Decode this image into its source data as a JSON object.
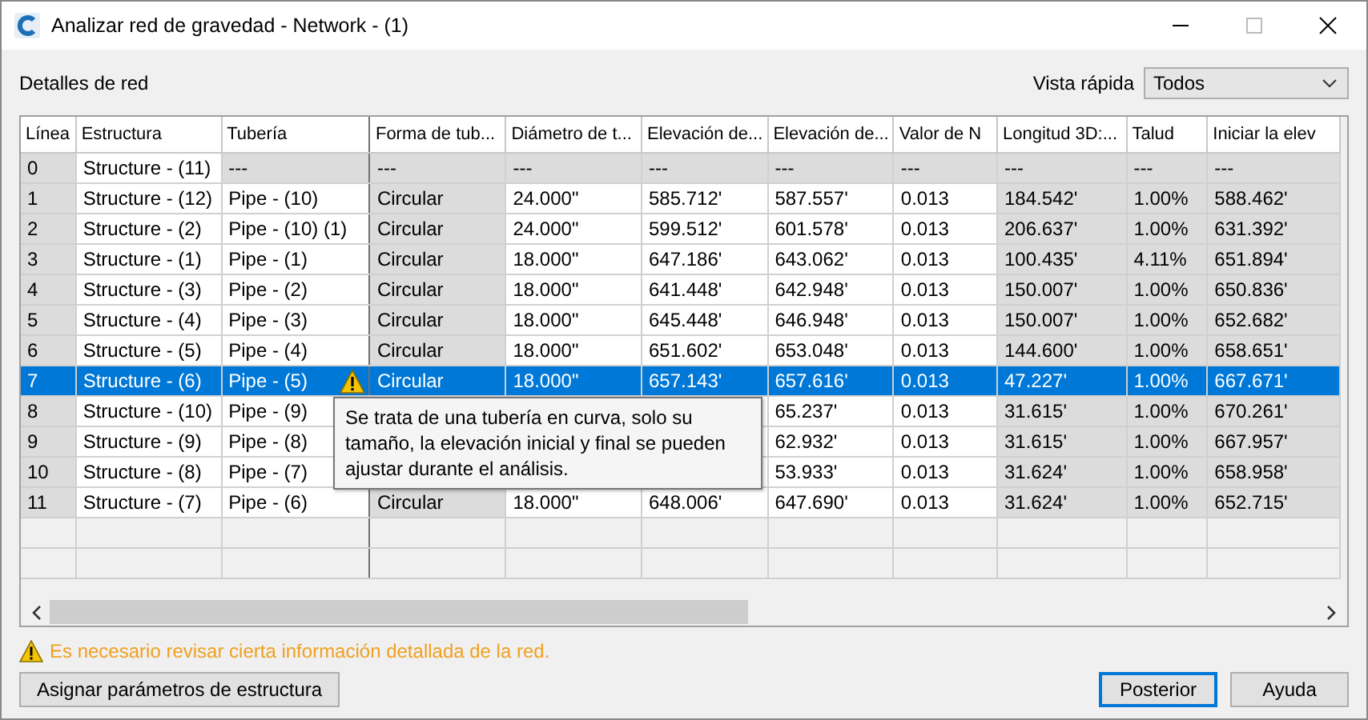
{
  "window": {
    "title": "Analizar red de gravedad - Network - (1)"
  },
  "section_label": "Detalles de red",
  "quick_view": {
    "label": "Vista rápida",
    "value": "Todos"
  },
  "table": {
    "columns": [
      {
        "label": "Línea",
        "editable": false,
        "summary_editable": false,
        "frozen": false
      },
      {
        "label": "Estructura",
        "editable": true,
        "summary_editable": true,
        "frozen": false
      },
      {
        "label": "Tubería",
        "editable": true,
        "summary_editable": false,
        "frozen": true
      },
      {
        "label": "Forma de tub...",
        "editable": false,
        "summary_editable": false,
        "frozen": false
      },
      {
        "label": "Diámetro de t...",
        "editable": true,
        "summary_editable": false,
        "frozen": false
      },
      {
        "label": "Elevación de...",
        "editable": true,
        "summary_editable": false,
        "frozen": false
      },
      {
        "label": "Elevación de...",
        "editable": true,
        "summary_editable": false,
        "frozen": false
      },
      {
        "label": "Valor de N",
        "editable": true,
        "summary_editable": false,
        "frozen": false
      },
      {
        "label": "Longitud 3D:...",
        "editable": false,
        "summary_editable": false,
        "frozen": false
      },
      {
        "label": "Talud",
        "editable": false,
        "summary_editable": false,
        "frozen": false
      },
      {
        "label": "Iniciar la elev",
        "editable": false,
        "summary_editable": false,
        "frozen": false
      }
    ],
    "rows": [
      {
        "kind": "summary",
        "selected": false,
        "warning": false,
        "cells": [
          "0",
          "Structure - (11)",
          "---",
          "---",
          "---",
          "---",
          "---",
          "---",
          "---",
          "---",
          "---"
        ]
      },
      {
        "kind": "pipe",
        "selected": false,
        "warning": false,
        "cells": [
          "1",
          "Structure - (12)",
          "Pipe - (10)",
          "Circular",
          "24.000\"",
          "585.712'",
          "587.557'",
          "0.013",
          "184.542'",
          "1.00%",
          "588.462'"
        ]
      },
      {
        "kind": "pipe",
        "selected": false,
        "warning": false,
        "cells": [
          "2",
          "Structure - (2)",
          "Pipe - (10) (1)",
          "Circular",
          "24.000\"",
          "599.512'",
          "601.578'",
          "0.013",
          "206.637'",
          "1.00%",
          "631.392'"
        ]
      },
      {
        "kind": "pipe",
        "selected": false,
        "warning": false,
        "cells": [
          "3",
          "Structure - (1)",
          "Pipe - (1)",
          "Circular",
          "18.000\"",
          "647.186'",
          "643.062'",
          "0.013",
          "100.435'",
          "4.11%",
          "651.894'"
        ]
      },
      {
        "kind": "pipe",
        "selected": false,
        "warning": false,
        "cells": [
          "4",
          "Structure - (3)",
          "Pipe - (2)",
          "Circular",
          "18.000\"",
          "641.448'",
          "642.948'",
          "0.013",
          "150.007'",
          "1.00%",
          "650.836'"
        ]
      },
      {
        "kind": "pipe",
        "selected": false,
        "warning": false,
        "cells": [
          "5",
          "Structure - (4)",
          "Pipe - (3)",
          "Circular",
          "18.000\"",
          "645.448'",
          "646.948'",
          "0.013",
          "150.007'",
          "1.00%",
          "652.682'"
        ]
      },
      {
        "kind": "pipe",
        "selected": false,
        "warning": false,
        "cells": [
          "6",
          "Structure - (5)",
          "Pipe - (4)",
          "Circular",
          "18.000\"",
          "651.602'",
          "653.048'",
          "0.013",
          "144.600'",
          "1.00%",
          "658.651'"
        ]
      },
      {
        "kind": "pipe",
        "selected": true,
        "warning": true,
        "cells": [
          "7",
          "Structure - (6)",
          "Pipe - (5)",
          "Circular",
          "18.000\"",
          "657.143'",
          "657.616'",
          "0.013",
          "47.227'",
          "1.00%",
          "667.671'"
        ]
      },
      {
        "kind": "pipe",
        "selected": false,
        "warning": false,
        "cells": [
          "8",
          "Structure - (10)",
          "Pipe - (9)",
          null,
          null,
          null,
          "65.237'",
          "0.013",
          "31.615'",
          "1.00%",
          "670.261'"
        ]
      },
      {
        "kind": "pipe",
        "selected": false,
        "warning": false,
        "cells": [
          "9",
          "Structure - (9)",
          "Pipe - (8)",
          null,
          null,
          null,
          "62.932'",
          "0.013",
          "31.615'",
          "1.00%",
          "667.957'"
        ]
      },
      {
        "kind": "pipe",
        "selected": false,
        "warning": false,
        "cells": [
          "10",
          "Structure - (8)",
          "Pipe - (7)",
          null,
          null,
          null,
          "53.933'",
          "0.013",
          "31.624'",
          "1.00%",
          "658.958'"
        ]
      },
      {
        "kind": "pipe",
        "selected": false,
        "warning": false,
        "cells": [
          "11",
          "Structure - (7)",
          "Pipe - (6)",
          "Circular",
          "18.000\"",
          "648.006'",
          "647.690'",
          "0.013",
          "31.624'",
          "1.00%",
          "652.715'"
        ]
      }
    ]
  },
  "tooltip": "Se trata de una tubería en curva, solo su tamaño, la elevación inicial y final se pueden ajustar durante el análisis.",
  "status_message": "Es necesario revisar cierta información detallada de la red.",
  "buttons": {
    "left": "Asignar parámetros de estructura",
    "primary": "Posterior",
    "help": "Ayuda"
  }
}
